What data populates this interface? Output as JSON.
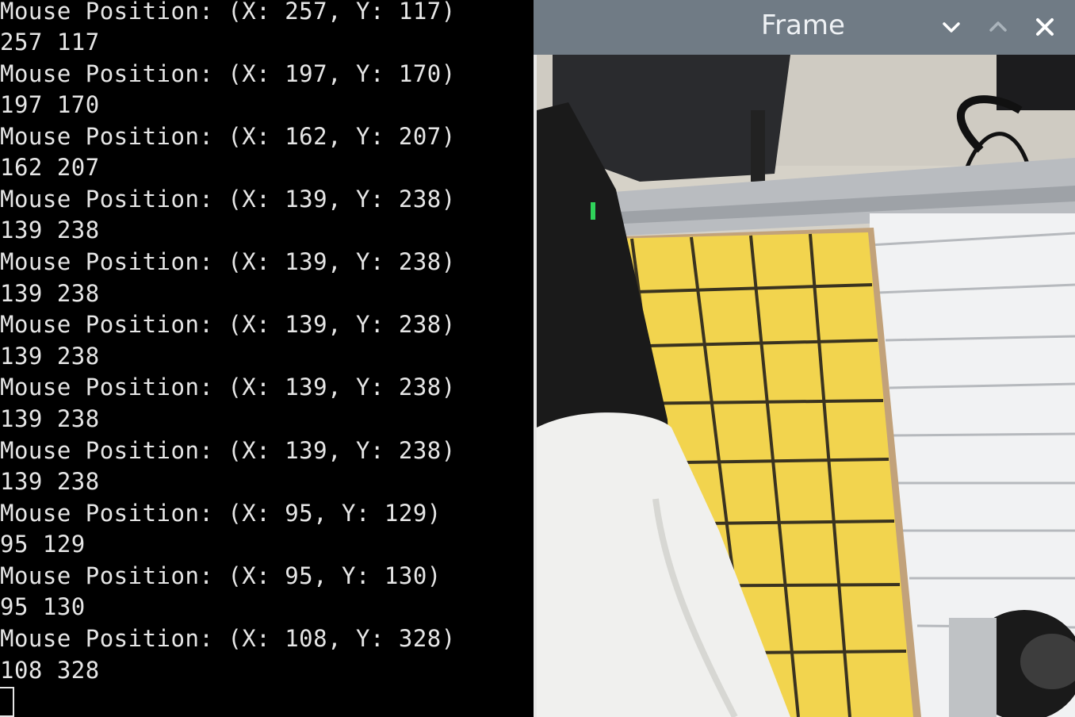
{
  "terminal": {
    "lines": [
      "Mouse Position: (X: 257, Y: 117)",
      "257 117",
      "Mouse Position: (X: 197, Y: 170)",
      "197 170",
      "Mouse Position: (X: 162, Y: 207)",
      "162 207",
      "Mouse Position: (X: 139, Y: 238)",
      "139 238",
      "Mouse Position: (X: 139, Y: 238)",
      "139 238",
      "Mouse Position: (X: 139, Y: 238)",
      "139 238",
      "Mouse Position: (X: 139, Y: 238)",
      "139 238",
      "Mouse Position: (X: 139, Y: 238)",
      "139 238",
      "Mouse Position: (X: 95, Y: 129)",
      "95 129",
      "Mouse Position: (X: 95, Y: 130)",
      "95 130",
      "Mouse Position: (X: 108, Y: 328)",
      "108 328"
    ]
  },
  "window": {
    "title": "Frame",
    "buttons": {
      "minimize_icon": "chevron-down-icon",
      "maximize_icon": "chevron-up-icon",
      "close_icon": "close-icon"
    }
  },
  "colors": {
    "titlebar": "#707b85",
    "board_yellow": "#f2d44e",
    "terminal_text": "#e6e6e6"
  }
}
